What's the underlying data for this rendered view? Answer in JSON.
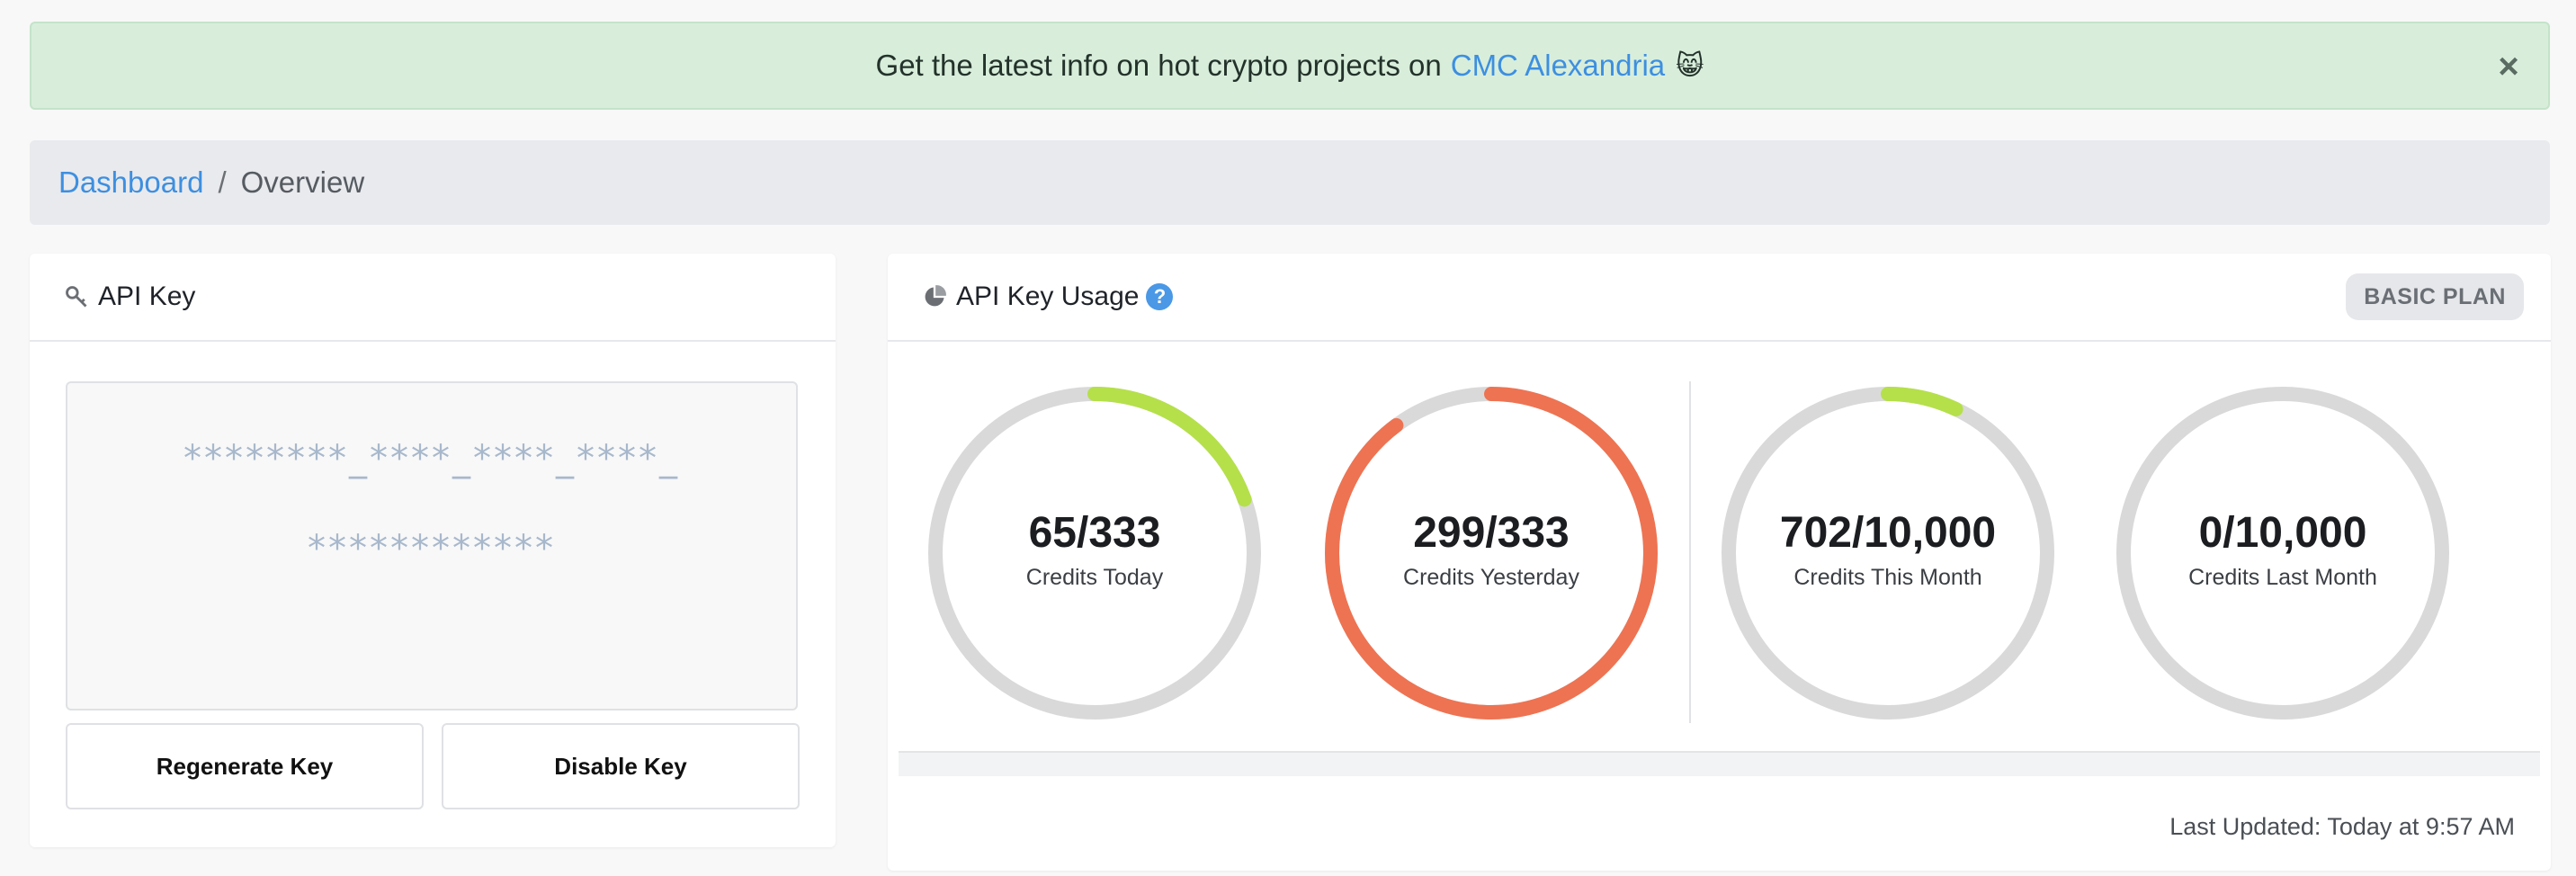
{
  "banner": {
    "text": "Get the latest info on hot crypto projects on",
    "link_text": "CMC Alexandria",
    "emoji": "😸",
    "close_symbol": "×",
    "background_color": "#d8eedb",
    "link_color": "#3d8fe0"
  },
  "breadcrumb": {
    "root": "Dashboard",
    "separator": "/",
    "current": "Overview"
  },
  "api_key_card": {
    "title": "API Key",
    "icon": "key-icon",
    "key_line_1": "********_****_****_****_",
    "key_line_2": "************",
    "regenerate_label": "Regenerate Key",
    "disable_label": "Disable Key"
  },
  "usage_card": {
    "title": "API Key Usage",
    "icon": "pie-chart-icon",
    "help_symbol": "?",
    "plan_badge": "BASIC PLAN",
    "last_updated": "Last Updated: Today at 9:57 AM",
    "gauges": [
      {
        "value": "65/333",
        "label": "Credits Today",
        "used": 65,
        "total": 333,
        "color": "#b5e04a"
      },
      {
        "value": "299/333",
        "label": "Credits Yesterday",
        "used": 299,
        "total": 333,
        "color": "#ee7352"
      },
      {
        "value": "702/10,000",
        "label": "Credits This Month",
        "used": 702,
        "total": 10000,
        "color": "#b5e04a"
      },
      {
        "value": "0/10,000",
        "label": "Credits Last Month",
        "used": 0,
        "total": 10000,
        "color": "#b5e04a"
      }
    ],
    "track_color": "#d9d9d9"
  }
}
